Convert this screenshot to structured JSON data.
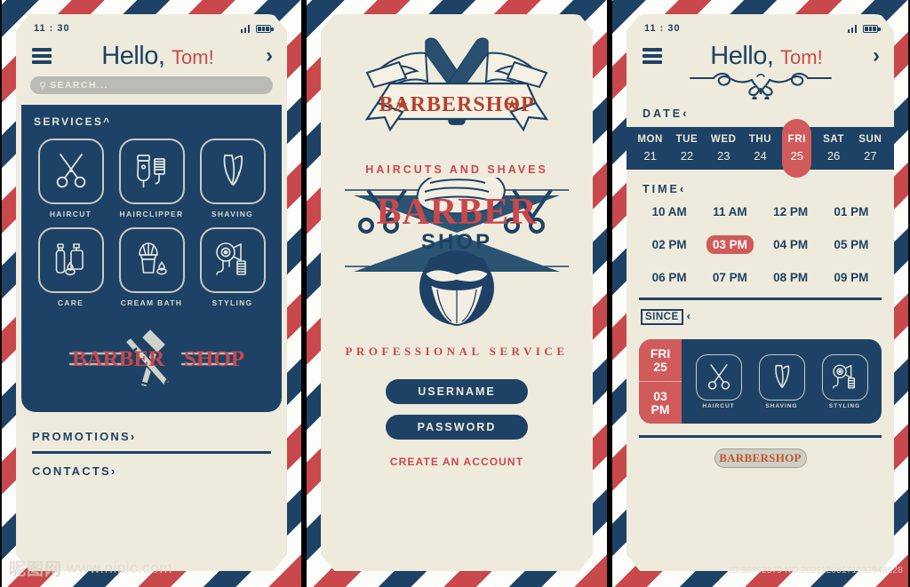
{
  "theme": {
    "navy": "#1d4265",
    "cream": "#efebdc",
    "red": "#d15a5a",
    "red_dark": "#c9484c",
    "white": "#fdfdfb"
  },
  "panel1": {
    "status": {
      "time": "11 : 30",
      "signal_icon": "signal-bars-icon",
      "battery_icon": "battery-icon"
    },
    "menu_icon": "hamburger-menu-icon",
    "greeting": "Hello,",
    "user_name": "Tom!",
    "forward_icon": "chevron-right-icon",
    "search": {
      "placeholder": "SEARCH...",
      "icon": "search-icon"
    },
    "services_label": "SERVICES^",
    "services": [
      {
        "label": "HAIRCUT",
        "icon": "scissors-icon"
      },
      {
        "label": "HAIRCLIPPER",
        "icon": "hair-clipper-icon"
      },
      {
        "label": "SHAVING",
        "icon": "straight-razor-icon"
      },
      {
        "label": "CARE",
        "icon": "care-products-icon"
      },
      {
        "label": "CREAM BATH",
        "icon": "shaving-brush-icon"
      },
      {
        "label": "STYLING",
        "icon": "hair-dryer-icon"
      }
    ],
    "brand": {
      "word1": "BARBER",
      "word2": "SHOP",
      "icon": "scissors-razor-emblem-icon"
    },
    "links": [
      {
        "label": "PROMOTIONS",
        "chevron": "›"
      },
      {
        "label": "CONTACTS",
        "chevron": "›"
      }
    ]
  },
  "panel2": {
    "emblem_icon": "winged-razors-crest-icon",
    "emblem_banner": "BARBERSHOP",
    "tagline": "HAIRCUTS AND SHAVES",
    "logo": {
      "title": "BARBER",
      "subtitle": "SHOP",
      "footer": "PROFESSIONAL SERVICE",
      "icon": "bearded-barber-logo-icon"
    },
    "username_button": "USERNAME",
    "password_button": "PASSWORD",
    "create_account": "CREATE AN ACCOUNT"
  },
  "panel3": {
    "status": {
      "time": "11 : 30",
      "signal_icon": "signal-bars-icon",
      "battery_icon": "battery-icon"
    },
    "menu_icon": "hamburger-menu-icon",
    "greeting": "Hello,",
    "user_name": "Tom!",
    "forward_icon": "chevron-right-icon",
    "flourish_icon": "filigree-divider-icon",
    "date_label": "DATE",
    "date_chevron": "‹",
    "days": [
      {
        "name": "MON",
        "num": "21",
        "selected": false
      },
      {
        "name": "TUE",
        "num": "22",
        "selected": false
      },
      {
        "name": "WED",
        "num": "23",
        "selected": false
      },
      {
        "name": "THU",
        "num": "24",
        "selected": false
      },
      {
        "name": "FRI",
        "num": "25",
        "selected": true
      },
      {
        "name": "SAT",
        "num": "26",
        "selected": false
      },
      {
        "name": "SUN",
        "num": "27",
        "selected": false
      }
    ],
    "time_label": "TIME",
    "time_chevron": "‹",
    "times": [
      {
        "label": "10 AM",
        "selected": false
      },
      {
        "label": "11 AM",
        "selected": false
      },
      {
        "label": "12 PM",
        "selected": false
      },
      {
        "label": "01 PM",
        "selected": false
      },
      {
        "label": "02 PM",
        "selected": false
      },
      {
        "label": "03 PM",
        "selected": true
      },
      {
        "label": "04 PM",
        "selected": false
      },
      {
        "label": "05 PM",
        "selected": false
      },
      {
        "label": "06 PM",
        "selected": false
      },
      {
        "label": "07 PM",
        "selected": false
      },
      {
        "label": "08 PM",
        "selected": false
      },
      {
        "label": "09 PM",
        "selected": false
      }
    ],
    "since_label": "SINCE",
    "since_chevron": "‹",
    "booking": {
      "day_name": "FRI",
      "day_num": "25",
      "hour": "03",
      "meridiem": "PM",
      "items": [
        {
          "label": "HAIRCUT",
          "icon": "scissors-icon"
        },
        {
          "label": "SHAVING",
          "icon": "straight-razor-icon"
        },
        {
          "label": "STYLING",
          "icon": "hair-dryer-icon"
        }
      ]
    },
    "cta_button": "BARBERSHOP"
  },
  "watermark": {
    "cjk": "昵图网",
    "url": "www.nipic.com",
    "id_text": "ID:30762879 NO:20211205171032948128"
  }
}
